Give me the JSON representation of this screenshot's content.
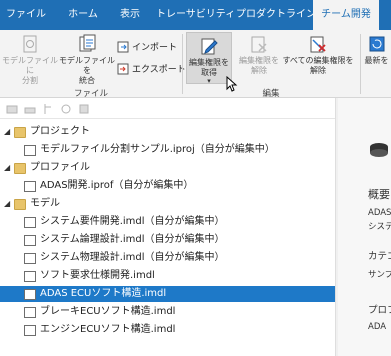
{
  "tabs": [
    {
      "label": "ファイル",
      "active": false
    },
    {
      "label": "ホーム",
      "active": false
    },
    {
      "label": "表示",
      "active": false
    },
    {
      "label": "トレーサビリティ",
      "active": false
    },
    {
      "label": "プロダクトライン",
      "active": false
    },
    {
      "label": "チーム開発",
      "active": true
    }
  ],
  "ribbon": {
    "file_group": {
      "label": "ファイル",
      "split_model": "モデルファイルに\n分割",
      "merge_model": "モデルファイルを\n統合",
      "import": "インポート",
      "export": "エクスポート"
    },
    "edit_group": {
      "label": "編集",
      "acquire": "編集権限を\n取得",
      "release": "編集権限を\n解除",
      "release_all": "すべての編集権限を\n解除"
    },
    "latest_group": {
      "latest": "最新を"
    }
  },
  "tree": [
    {
      "level": 0,
      "type": "folder",
      "label": "プロジェクト",
      "expanded": true
    },
    {
      "level": 1,
      "type": "doc",
      "label": "モデルファイル分割サンプル.iproj（自分が編集中）"
    },
    {
      "level": 0,
      "type": "folder",
      "label": "プロファイル",
      "expanded": true
    },
    {
      "level": 1,
      "type": "doc",
      "label": "ADAS開発.iprof（自分が編集中）"
    },
    {
      "level": 0,
      "type": "folder",
      "label": "モデル",
      "expanded": true
    },
    {
      "level": 1,
      "type": "doc",
      "label": "システム要件開発.imdl（自分が編集中）"
    },
    {
      "level": 1,
      "type": "doc",
      "label": "システム論理設計.imdl（自分が編集中）"
    },
    {
      "level": 1,
      "type": "doc",
      "label": "システム物理設計.imdl（自分が編集中）"
    },
    {
      "level": 1,
      "type": "doc",
      "label": "ソフト要求仕様開発.imdl"
    },
    {
      "level": 1,
      "type": "doc",
      "label": "ADAS ECUソフト構造.imdl",
      "selected": true
    },
    {
      "level": 1,
      "type": "doc",
      "label": "ブレーキECUソフト構造.imdl"
    },
    {
      "level": 1,
      "type": "doc",
      "label": "エンジンECUソフト構造.imdl"
    }
  ],
  "right_panel": {
    "overview": "概要",
    "line1": "ADAS",
    "line2": "システ",
    "category": "カテゴ",
    "category_val": "サンプ",
    "profile": "プロフ",
    "profile_val": "ADA"
  },
  "colors": {
    "ribbon_blue": "#1f6fb5",
    "selection": "#1e79c8",
    "folder": "#e8c46a"
  }
}
